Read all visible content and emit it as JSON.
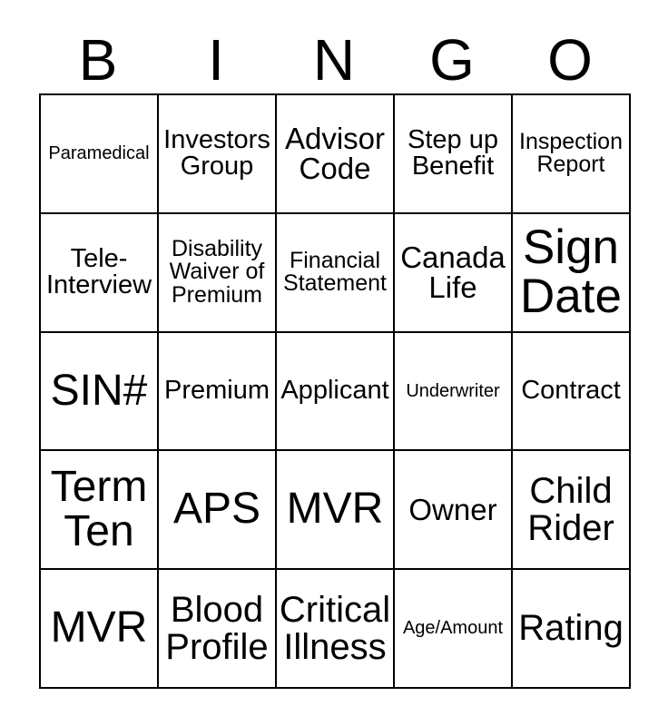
{
  "card": {
    "type": "bingo-card",
    "header": {
      "letters": [
        "B",
        "I",
        "N",
        "G",
        "O"
      ]
    },
    "grid": {
      "columns": 5,
      "rows": 5,
      "border_color": "#000000",
      "background_color": "#ffffff",
      "text_color": "#000000"
    },
    "cells": [
      [
        {
          "text": "Paramedical",
          "size": "xs"
        },
        {
          "text": "Investors Group",
          "size": "md"
        },
        {
          "text": "Advisor Code",
          "size": "lg"
        },
        {
          "text": "Step up Benefit",
          "size": "md"
        },
        {
          "text": "Inspection Report",
          "size": "sm"
        }
      ],
      [
        {
          "text": "Tele-Interview",
          "size": "md"
        },
        {
          "text": "Disability Waiver of Premium",
          "size": "sm"
        },
        {
          "text": "Financial Statement",
          "size": "sm"
        },
        {
          "text": "Canada Life",
          "size": "lg"
        },
        {
          "text": "Sign Date",
          "size": "huge"
        }
      ],
      [
        {
          "text": "SIN#",
          "size": "xxl"
        },
        {
          "text": "Premium",
          "size": "md"
        },
        {
          "text": "Applicant",
          "size": "md"
        },
        {
          "text": "Underwriter",
          "size": "xs"
        },
        {
          "text": "Contract",
          "size": "md"
        }
      ],
      [
        {
          "text": "Term Ten",
          "size": "xxl"
        },
        {
          "text": "APS",
          "size": "xxl"
        },
        {
          "text": "MVR",
          "size": "xxl"
        },
        {
          "text": "Owner",
          "size": "lg"
        },
        {
          "text": "Child Rider",
          "size": "xl"
        }
      ],
      [
        {
          "text": "MVR",
          "size": "xxl"
        },
        {
          "text": "Blood Profile",
          "size": "xl"
        },
        {
          "text": "Critical Illness",
          "size": "xl"
        },
        {
          "text": "Age/Amount",
          "size": "xs"
        },
        {
          "text": "Rating",
          "size": "xl"
        }
      ]
    ]
  }
}
